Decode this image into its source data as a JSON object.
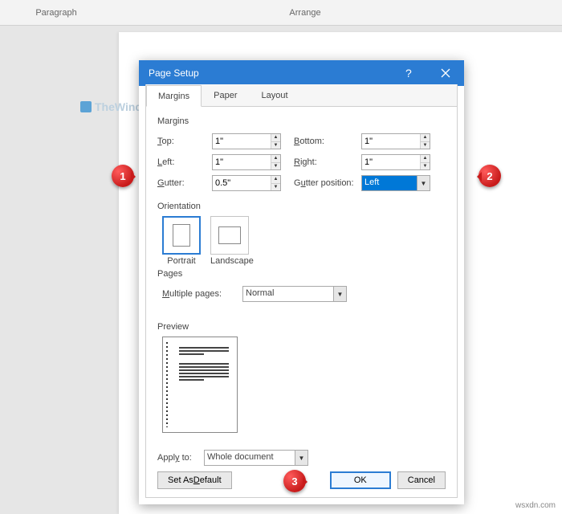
{
  "ribbon": {
    "group1": "Paragraph",
    "group2": "Arrange"
  },
  "watermark": "TheWindowsClub",
  "dialog": {
    "title": "Page Setup",
    "tabs": {
      "margins": "Margins",
      "paper": "Paper",
      "layout": "Layout"
    }
  },
  "margins": {
    "section": "Margins",
    "top_label": "Top:",
    "top_value": "1\"",
    "bottom_label": "Bottom:",
    "bottom_value": "1\"",
    "left_label": "Left:",
    "left_value": "1\"",
    "right_label": "Right:",
    "right_value": "1\"",
    "gutter_label": "Gutter:",
    "gutter_value": "0.5\"",
    "gutter_pos_label": "Gutter position:",
    "gutter_pos_value": "Left"
  },
  "orientation": {
    "section": "Orientation",
    "portrait": "Portrait",
    "landscape": "Landscape"
  },
  "pages": {
    "section": "Pages",
    "multiple_label": "Multiple pages:",
    "multiple_value": "Normal"
  },
  "preview": {
    "section": "Preview"
  },
  "apply": {
    "label": "Apply to:",
    "value": "Whole document"
  },
  "buttons": {
    "default": "Set As Default",
    "ok": "OK",
    "cancel": "Cancel"
  },
  "callouts": {
    "c1": "1",
    "c2": "2",
    "c3": "3"
  },
  "credit": "wsxdn.com"
}
